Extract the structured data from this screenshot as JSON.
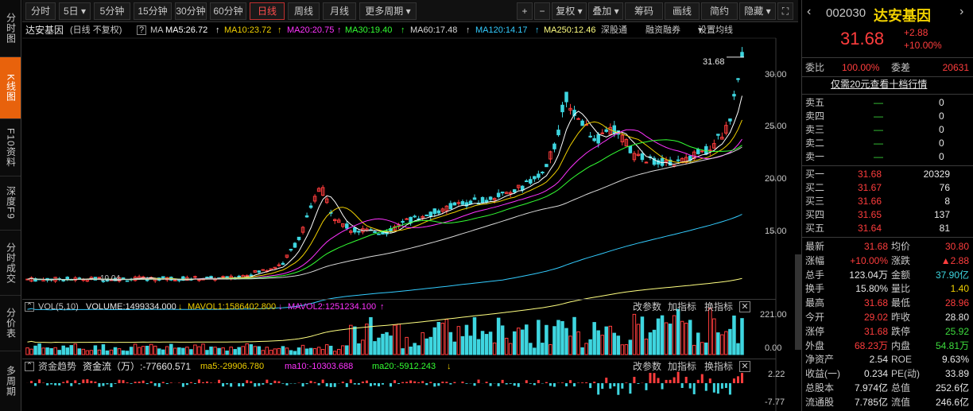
{
  "left_tabs": [
    {
      "label": "分时图",
      "active": false
    },
    {
      "label": "K线图",
      "active": true
    },
    {
      "label": "F10资料",
      "active": false
    },
    {
      "label": "深度F9",
      "active": false
    },
    {
      "label": "分时成交",
      "active": false
    },
    {
      "label": "分价表",
      "active": false
    },
    {
      "label": "多周期",
      "active": false
    }
  ],
  "toolbar": {
    "periods": [
      {
        "label": "分时",
        "active": false
      },
      {
        "label": "5日",
        "dropdown": true,
        "active": false
      },
      {
        "label": "5分钟",
        "active": false
      },
      {
        "label": "15分钟",
        "active": false
      },
      {
        "label": "30分钟",
        "active": false
      },
      {
        "label": "60分钟",
        "active": false
      },
      {
        "label": "日线",
        "active": true
      },
      {
        "label": "周线",
        "active": false
      },
      {
        "label": "月线",
        "active": false
      },
      {
        "label": "更多周期",
        "dropdown": true,
        "active": false
      }
    ],
    "zoom_in": "+",
    "zoom_out": "−",
    "tools": [
      {
        "label": "复权",
        "dropdown": true
      },
      {
        "label": "叠加",
        "dropdown": true
      },
      {
        "label": "筹码"
      },
      {
        "label": "画线"
      },
      {
        "label": "简约"
      },
      {
        "label": "隐藏",
        "dropdown": true
      }
    ],
    "fullscreen_icon": "expand-icon"
  },
  "kline": {
    "name": "达安基因",
    "mode": "(日线 不复权)",
    "ma_label": "MA",
    "ma": [
      {
        "label": "MA5:26.72",
        "color": "#ffffff"
      },
      {
        "label": "MA10:23.72",
        "color": "#f0d000"
      },
      {
        "label": "MA20:20.75",
        "color": "#ff33ff"
      },
      {
        "label": "MA30:19.40",
        "color": "#33ff33"
      },
      {
        "label": "MA60:17.48",
        "color": "#d8d8d8"
      },
      {
        "label": "MA120:14.17",
        "color": "#33ccff"
      },
      {
        "label": "MA250:12.46",
        "color": "#ffff80"
      }
    ],
    "links": [
      "深股通",
      "融资融券"
    ],
    "settings_label": "设置均线",
    "price_ticks": [
      "30.00",
      "25.00",
      "20.00",
      "15.00"
    ],
    "last_price_label": "31.68",
    "low_label": "10.04"
  },
  "volume": {
    "title": "VOL(5,10)",
    "volume": "VOLUME:1499334.000",
    "mavol1": "MAVOL1:1586402.800",
    "mavol2": "MAVOL2:1251234.100",
    "ticks": [
      "221.00",
      "0.00"
    ],
    "buttons": [
      "改参数",
      "加指标",
      "换指标"
    ]
  },
  "fund_flow": {
    "title": "资金趋势",
    "value": "资金流（万）:-77660.571",
    "ma5": "ma5:-29906.780",
    "ma10": "ma10:-10303.688",
    "ma20": "ma20:-5912.243",
    "ticks": [
      "2.22",
      "-7.77"
    ],
    "buttons": [
      "改参数",
      "加指标",
      "换指标"
    ]
  },
  "quote": {
    "code": "002030",
    "name": "达安基因",
    "price": "31.68",
    "change": "+2.88",
    "change_pct": "+10.00%",
    "weibi_label": "委比",
    "weibi": "100.00%",
    "weicha_label": "委差",
    "weicha": "20631",
    "level2_link": "仅需20元查看十档行情",
    "asks": [
      {
        "label": "卖五",
        "price": "—",
        "vol": "0"
      },
      {
        "label": "卖四",
        "price": "—",
        "vol": "0"
      },
      {
        "label": "卖三",
        "price": "—",
        "vol": "0"
      },
      {
        "label": "卖二",
        "price": "—",
        "vol": "0"
      },
      {
        "label": "卖一",
        "price": "—",
        "vol": "0"
      }
    ],
    "bids": [
      {
        "label": "买一",
        "price": "31.68",
        "vol": "20329"
      },
      {
        "label": "买二",
        "price": "31.67",
        "vol": "76"
      },
      {
        "label": "买三",
        "price": "31.66",
        "vol": "8"
      },
      {
        "label": "买四",
        "price": "31.65",
        "vol": "137"
      },
      {
        "label": "买五",
        "price": "31.64",
        "vol": "81"
      }
    ],
    "stats": [
      {
        "l1": "最新",
        "v1": "31.68",
        "c1": "red",
        "l2": "均价",
        "v2": "30.80",
        "c2": "red"
      },
      {
        "l1": "涨幅",
        "v1": "+10.00%",
        "c1": "red",
        "l2": "涨跌",
        "v2": "▲2.88",
        "c2": "red"
      },
      {
        "l1": "总手",
        "v1": "123.04万",
        "c1": "white",
        "l2": "金额",
        "v2": "37.90亿",
        "c2": "cyan"
      },
      {
        "l1": "换手",
        "v1": "15.80%",
        "c1": "white",
        "l2": "量比",
        "v2": "1.40",
        "c2": "yellow"
      },
      {
        "l1": "最高",
        "v1": "31.68",
        "c1": "red",
        "l2": "最低",
        "v2": "28.96",
        "c2": "red"
      },
      {
        "l1": "今开",
        "v1": "29.02",
        "c1": "red",
        "l2": "昨收",
        "v2": "28.80",
        "c2": "white"
      },
      {
        "l1": "涨停",
        "v1": "31.68",
        "c1": "red",
        "l2": "跌停",
        "v2": "25.92",
        "c2": "green"
      },
      {
        "l1": "外盘",
        "v1": "68.23万",
        "c1": "red",
        "l2": "内盘",
        "v2": "54.81万",
        "c2": "green"
      },
      {
        "l1": "净资产",
        "v1": "2.54",
        "c1": "white",
        "l2": "ROE",
        "v2": "9.63%",
        "c2": "white"
      },
      {
        "l1": "收益(一)",
        "v1": "0.234",
        "c1": "white",
        "l2": "PE(动)",
        "v2": "33.89",
        "c2": "white"
      },
      {
        "l1": "总股本",
        "v1": "7.974亿",
        "c1": "white",
        "l2": "总值",
        "v2": "252.6亿",
        "c2": "white"
      },
      {
        "l1": "流通股",
        "v1": "7.785亿",
        "c1": "white",
        "l2": "流值",
        "v2": "246.6亿",
        "c2": "white"
      }
    ]
  },
  "colors": {
    "up": "#ff3d3d",
    "down": "#3ed6e0",
    "accent": "#e8620c"
  }
}
